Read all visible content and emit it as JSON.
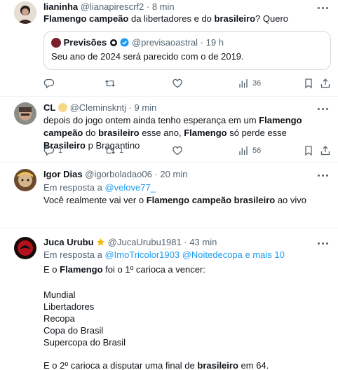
{
  "tweets": [
    {
      "name": "lianinha",
      "handle": "@lianapirescrf2",
      "time": "· 8 min",
      "text": [
        {
          "t": "Flamengo campeão",
          "b": true
        },
        {
          "t": " da libertadores e do ",
          "b": false
        },
        {
          "t": "brasileiro",
          "b": true
        },
        {
          "t": "? Quero",
          "b": false
        }
      ],
      "quote": {
        "name": "Previsões",
        "handle": "@previsaoastral",
        "time": "· 19 h",
        "text": "Seu ano de 2024 será parecido com o de 2019."
      },
      "actions": {
        "reply": "",
        "retweet": "",
        "like": "",
        "views": "36"
      }
    },
    {
      "name": "CL",
      "handle": "@Cleminskntj",
      "time": "· 9 min",
      "text": [
        {
          "t": "depois do jogo ontem ainda tenho esperança em um ",
          "b": false
        },
        {
          "t": "Flamengo campeão",
          "b": true
        },
        {
          "t": " do ",
          "b": false
        },
        {
          "t": "brasileiro",
          "b": true
        },
        {
          "t": " esse ano, ",
          "b": false
        },
        {
          "t": "Flamengo",
          "b": true
        },
        {
          "t": " só perde esse ",
          "b": false
        },
        {
          "t": "Brasileiro",
          "b": true
        },
        {
          "t": " p Bragantino",
          "b": false
        }
      ],
      "actions": {
        "reply": "1",
        "retweet": "1",
        "like": "",
        "views": "56"
      }
    },
    {
      "name": "Igor Dias",
      "handle": "@igorboladao06",
      "time": "· 20 min",
      "reply_prefix": "Em resposta a ",
      "reply_targets": "@velove77_",
      "text": [
        {
          "t": "Você realmente vai ver o ",
          "b": false
        },
        {
          "t": "Flamengo campeão brasileiro",
          "b": true
        },
        {
          "t": " ao vivo",
          "b": false
        }
      ],
      "actions": {
        "reply": "",
        "retweet": "",
        "like": "",
        "views": ""
      }
    },
    {
      "name": "Juca Urubu",
      "handle": "@JucaUrubu1981",
      "time": "· 43 min",
      "reply_prefix": "Em resposta a ",
      "reply_targets": "@ImoTricolor1903 @Noitedecopa e mais 10",
      "lines": [
        [
          {
            "t": "E o ",
            "b": false
          },
          {
            "t": "Flamengo",
            "b": true
          },
          {
            "t": " foi o 1º carioca a vencer:",
            "b": false
          }
        ],
        [],
        [
          {
            "t": "Mundial",
            "b": false
          }
        ],
        [
          {
            "t": "Libertadores",
            "b": false
          }
        ],
        [
          {
            "t": "Recopa",
            "b": false
          }
        ],
        [
          {
            "t": "Copa do Brasil",
            "b": false
          }
        ],
        [
          {
            "t": "Supercopa do Brasil",
            "b": false
          }
        ],
        [],
        [
          {
            "t": "E o 2º carioca a disputar uma final de ",
            "b": false
          },
          {
            "t": "brasileiro",
            "b": true
          },
          {
            "t": " em 64.",
            "b": false
          }
        ]
      ]
    }
  ],
  "colors": {
    "accent": "#1d9bf0",
    "muted": "#536471",
    "border": "#cfd9de",
    "gold": "#f2b705"
  }
}
